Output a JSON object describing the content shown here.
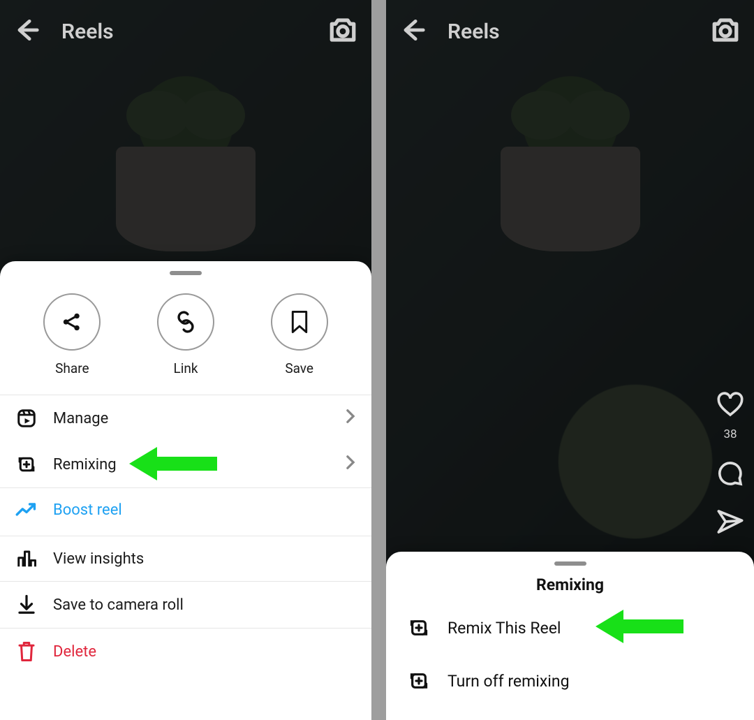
{
  "left": {
    "header": {
      "title": "Reels"
    },
    "sheet": {
      "round": {
        "share": "Share",
        "link": "Link",
        "save": "Save"
      },
      "items": {
        "manage": "Manage",
        "remixing": "Remixing",
        "boost": "Boost reel",
        "insights": "View insights",
        "save_roll": "Save to camera roll",
        "delete": "Delete"
      }
    }
  },
  "right": {
    "header": {
      "title": "Reels"
    },
    "engagement": {
      "likes": "38"
    },
    "sheet": {
      "title": "Remixing",
      "items": {
        "remix_this": "Remix This Reel",
        "turn_off": "Turn off remixing"
      }
    }
  }
}
